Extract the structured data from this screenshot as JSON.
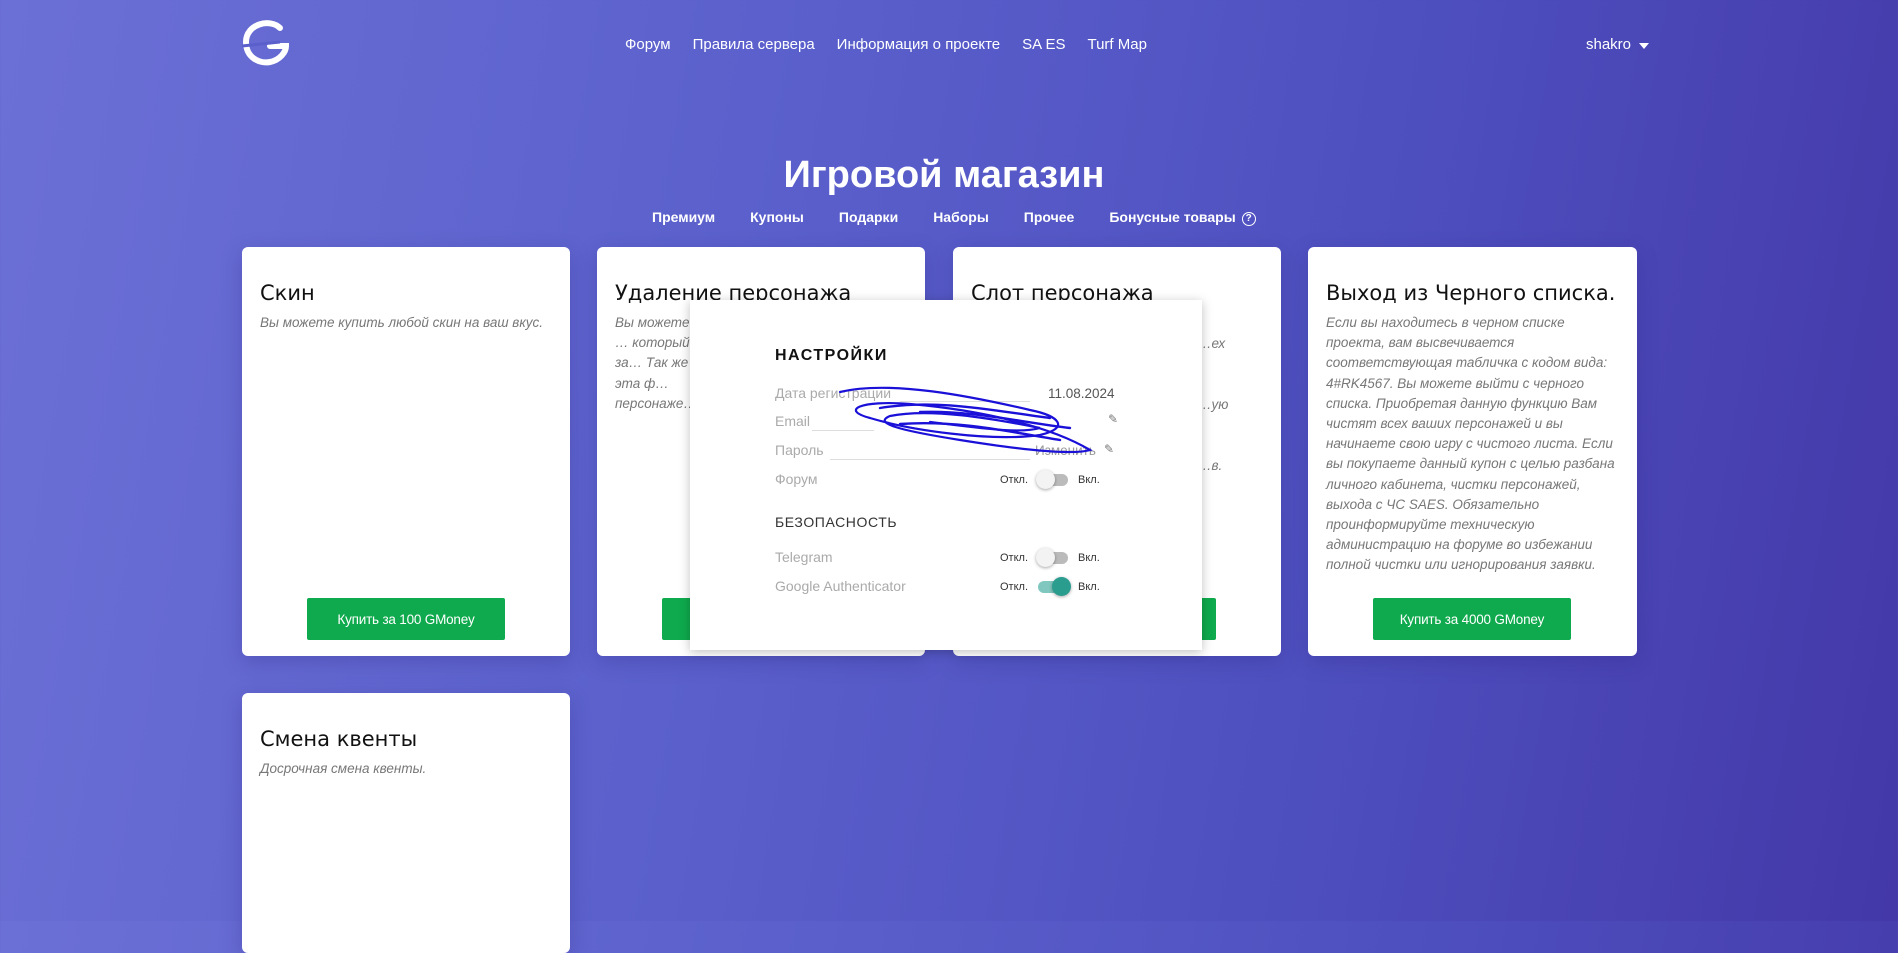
{
  "header": {
    "nav": [
      "Форум",
      "Правила сервера",
      "Информация о проекте",
      "SA ES",
      "Turf Map"
    ],
    "user": "shakro"
  },
  "shop": {
    "title": "Игровой магазин",
    "categories": [
      "Премиум",
      "Купоны",
      "Подарки",
      "Наборы",
      "Прочее",
      "Бонусные товары"
    ]
  },
  "cards": [
    {
      "title": "Скин",
      "desc": "Вы можете купить любой скин на ваш вкус.",
      "button": "Купить за 100 GMoney"
    },
    {
      "title": "Удаление персонажа",
      "desc": "Вы можете … который за… Так же эта ф… персонаже…",
      "button": ""
    },
    {
      "title": "Слот персонажа",
      "desc": "…ех …ую …в.",
      "button": ""
    },
    {
      "title": "Выход из Черного списка.",
      "desc": "Если вы находитесь в черном списке проекта, вам высвечивается соответствующая табличка с кодом вида: 4#RK4567. Вы можете выйти с черного списка. Приобретая данную функцию Вам чистят всех ваших персонажей и вы начинаете свою игру с чистого листа. Если вы покупаете данный купон с целью разбана личного кабинета, чистки персонажей, выхода с ЧС SAES. Обязательно проинформируйте техническую администрацию на форуме во избежании полной чистки или игнорирования заявки.",
      "button": "Купить за 4000 GMoney"
    },
    {
      "title": "Смена квенты",
      "desc": "Досрочная смена квенты.",
      "button": ""
    }
  ],
  "settings": {
    "title": "НАСТРОЙКИ",
    "reg_label": "Дата регистрации",
    "reg_date": "11.08.2024",
    "email_label": "Email",
    "password_label": "Пароль",
    "password_action": "Изменить",
    "forum_label": "Форум",
    "off": "Откл.",
    "on": "Вкл.",
    "security_title": "БЕЗОПАСНОСТЬ",
    "telegram_label": "Telegram",
    "ga_label": "Google Authenticator",
    "toggles": {
      "forum": false,
      "telegram": false,
      "google_authenticator": true
    }
  },
  "colors": {
    "buy_button": "#0faa4d",
    "toggle_on": "#2a9d8f",
    "scribble": "#1a10d8"
  }
}
